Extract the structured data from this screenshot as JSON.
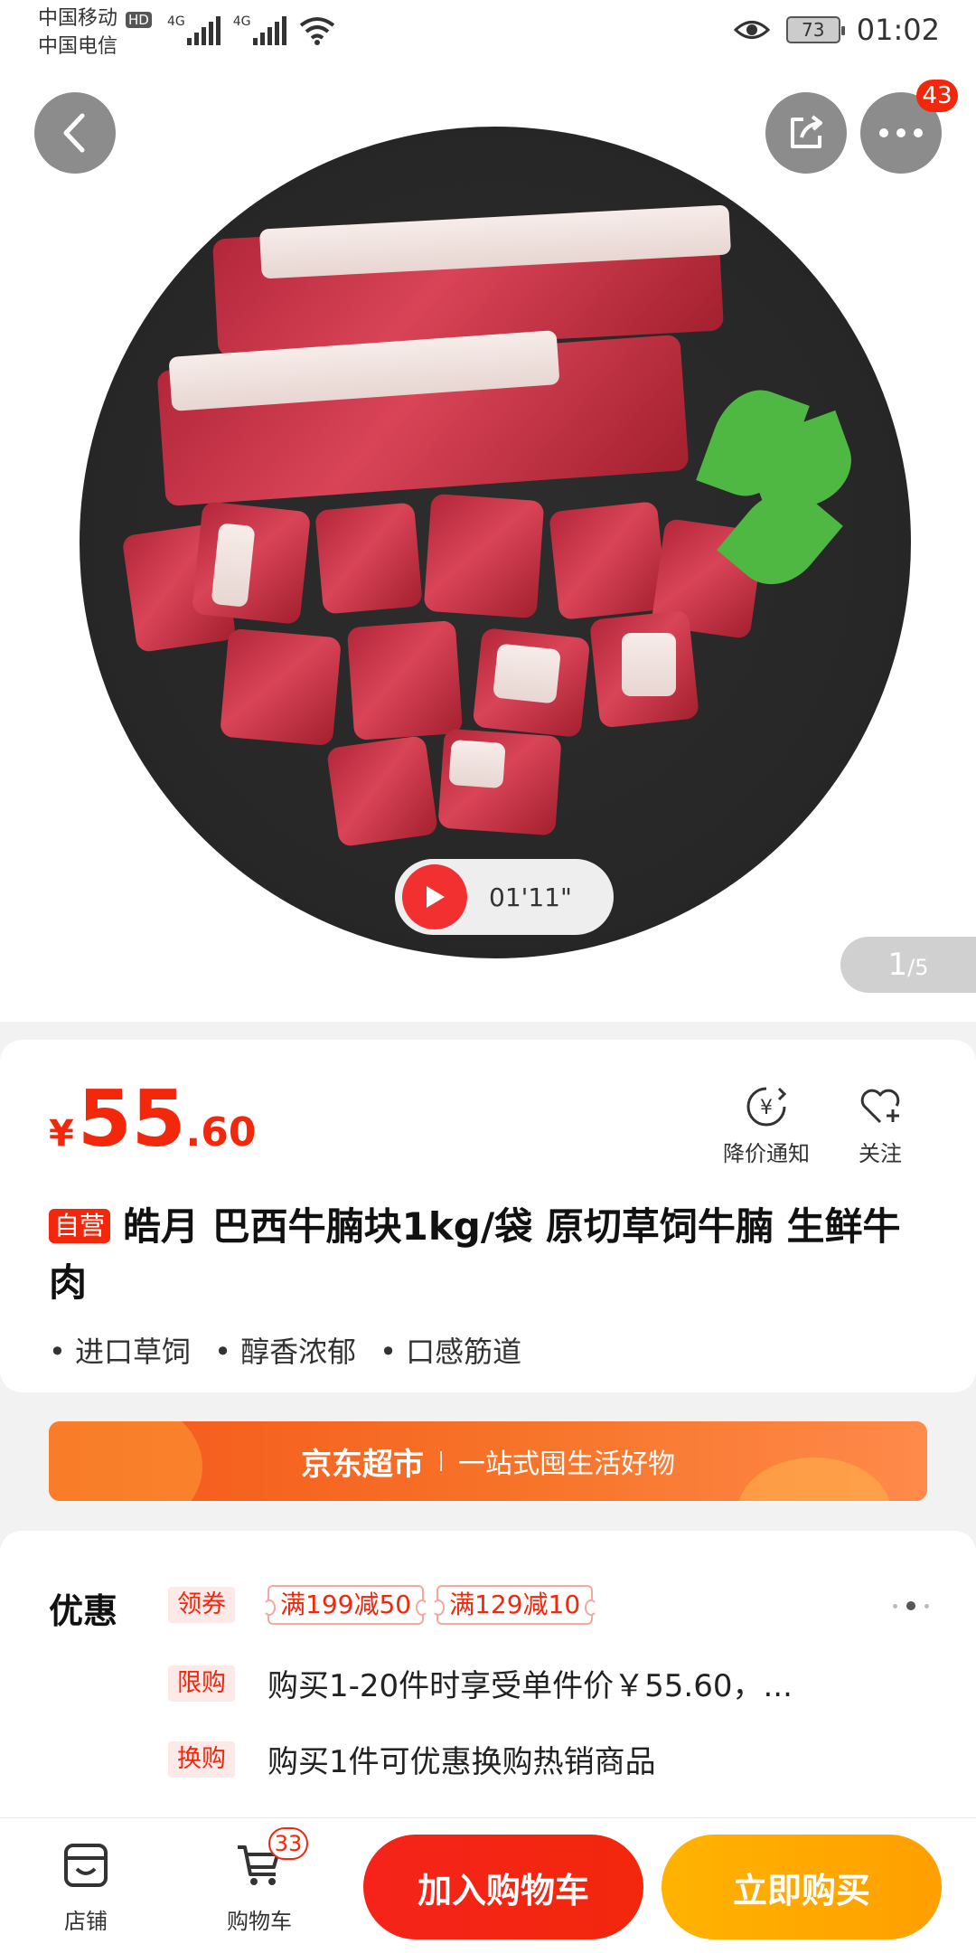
{
  "status_bar": {
    "carrier1": "中国移动",
    "hd": "HD",
    "carrier2": "中国电信",
    "network": "4G",
    "battery": "73",
    "time": "01:02"
  },
  "header": {
    "more_badge": "43"
  },
  "gallery": {
    "video_duration": "01'11\"",
    "page_current": "1",
    "page_total": "/5"
  },
  "product": {
    "price_symbol": "¥",
    "price_int": "55",
    "price_dec": ".60",
    "price_alert_label": "降价通知",
    "follow_label": "关注",
    "self_tag": "自营",
    "title": "皓月 巴西牛腩块1kg/袋 原切草饲牛腩 生鲜牛肉",
    "features": [
      "• 进口草饲",
      "• 醇香浓郁",
      "• 口感筋道"
    ]
  },
  "banner": {
    "brand": "京东超市",
    "slogan": "一站式囤生活好物"
  },
  "promo": {
    "title": "优惠",
    "coupon_tag": "领券",
    "coupons": [
      "满199减50",
      "满129减10"
    ],
    "limit_tag": "限购",
    "limit_text": "购买1-20件时享受单件价￥55.60，...",
    "exchange_tag": "换购",
    "exchange_text": "购买1件可优惠换购热销商品"
  },
  "bottom_bar": {
    "shop_label": "店铺",
    "cart_label": "购物车",
    "cart_badge": "33",
    "add_to_cart": "加入购物车",
    "buy_now": "立即购买"
  },
  "colors": {
    "accent_red": "#f2270c",
    "buy_orange": "#ffa800",
    "banner_orange": "#f5561a"
  }
}
